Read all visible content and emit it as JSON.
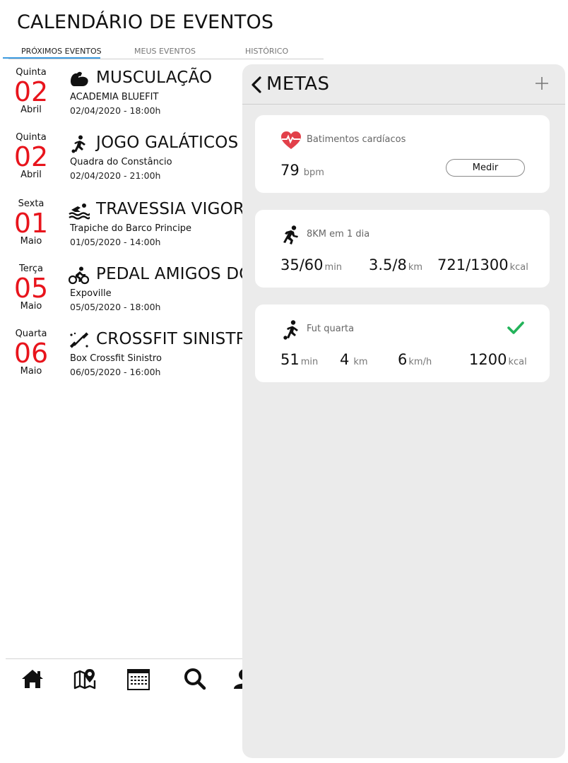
{
  "app": {
    "title": "CALENDÁRIO DE EVENTOS",
    "tabs": [
      {
        "label": "PRÓXIMOS EVENTOS",
        "active": true
      },
      {
        "label": "MEUS EVENTOS",
        "active": false
      },
      {
        "label": "HISTÓRICO",
        "active": false
      }
    ]
  },
  "events": [
    {
      "weekday": "Quinta",
      "day": "02",
      "month": "Abril",
      "icon": "muscle-icon",
      "title": "MUSCULAÇÃO",
      "place": "ACADEMIA BLUEFIT",
      "datetime": "02/04/2020  -  18:00h"
    },
    {
      "weekday": "Quinta",
      "day": "02",
      "month": "Abril",
      "icon": "soccer-icon",
      "title": "JOGO GALÁTICOS",
      "place": "Quadra do Constâncio",
      "datetime": "02/04/2020  -  21:00h"
    },
    {
      "weekday": "Sexta",
      "day": "01",
      "month": "Maio",
      "icon": "swimming-icon",
      "title": "TRAVESSIA VIGORE",
      "place": "Trapiche do Barco Principe",
      "datetime": "01/05/2020  -  14:00h"
    },
    {
      "weekday": "Terça",
      "day": "05",
      "month": "Maio",
      "icon": "cycling-icon",
      "title": "PEDAL AMIGOS DO",
      "place": "Expoville",
      "datetime": "05/05/2020  -  18:00h"
    },
    {
      "weekday": "Quarta",
      "day": "06",
      "month": "Maio",
      "icon": "crossfit-icon",
      "title": "CROSSFIT SINISTRO",
      "place": "Box Crossfit Sinistro",
      "datetime": "06/05/2020  -  16:00h"
    }
  ],
  "bottom_nav": [
    "home-icon",
    "map-pin-icon",
    "calendar-icon",
    "search-icon",
    "profile-icon"
  ],
  "goals_panel": {
    "title": "METAS",
    "cards": [
      {
        "icon": "heart-rate-icon",
        "label": "Batimentos cardíacos",
        "metrics": [
          {
            "value": "79",
            "unit": "bpm"
          }
        ],
        "button": "Medir"
      },
      {
        "icon": "running-icon",
        "label": "8KM em 1 dia",
        "metrics": [
          {
            "value": "35/60",
            "unit": "min"
          },
          {
            "value": "3.5/8",
            "unit": "km"
          },
          {
            "value": "721/1300",
            "unit": "kcal"
          }
        ]
      },
      {
        "icon": "soccer-icon",
        "label": "Fut quarta",
        "completed": true,
        "metrics": [
          {
            "value": "51",
            "unit": "min"
          },
          {
            "value": "4",
            "unit": "km"
          },
          {
            "value": "6",
            "unit": "km/h"
          },
          {
            "value": "1200",
            "unit": "kcal"
          }
        ]
      }
    ]
  },
  "colors": {
    "accent_red": "#e8141c",
    "tab_underline": "#3d9be0",
    "heart": "#e2404a",
    "check": "#23b35a",
    "panel_bg": "#ebebeb"
  }
}
